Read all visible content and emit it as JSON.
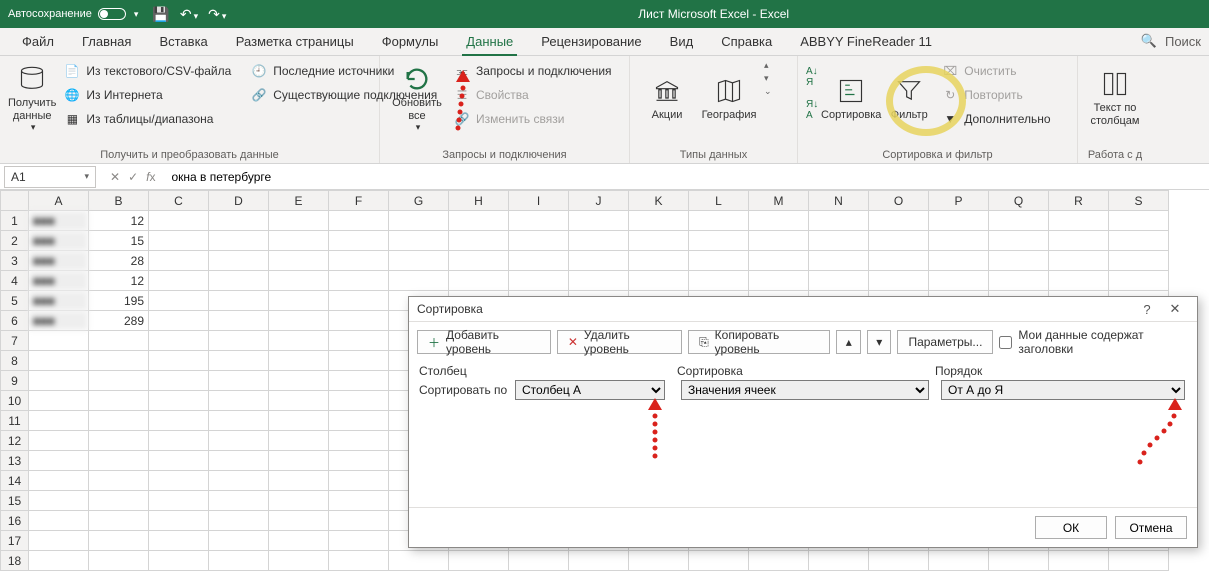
{
  "titlebar": {
    "autosave": "Автосохранение",
    "title": "Лист Microsoft Excel  -  Excel"
  },
  "tabs": {
    "file": "Файл",
    "home": "Главная",
    "insert": "Вставка",
    "layout": "Разметка страницы",
    "formulas": "Формулы",
    "data": "Данные",
    "review": "Рецензирование",
    "view": "Вид",
    "help": "Справка",
    "abbyy": "ABBYY FineReader 11",
    "search": "Поиск"
  },
  "ribbon": {
    "getdata": {
      "big": "Получить данные",
      "txtcsv": "Из текстового/CSV-файла",
      "web": "Из Интернета",
      "range": "Из таблицы/диапазона",
      "recent": "Последние источники",
      "existing": "Существующие подключения",
      "label": "Получить и преобразовать данные"
    },
    "refresh": {
      "big": "Обновить все",
      "queries": "Запросы и подключения",
      "props": "Свойства",
      "links": "Изменить связи",
      "label": "Запросы и подключения"
    },
    "dtypes": {
      "stocks": "Акции",
      "geo": "География",
      "label": "Типы данных"
    },
    "sortfilter": {
      "sort": "Сортировка",
      "filter": "Фильтр",
      "clear": "Очистить",
      "reapply": "Повторить",
      "advanced": "Дополнительно",
      "label": "Сортировка и фильтр"
    },
    "tools": {
      "ttc": "Текст по столбцам",
      "label": "Работа с д"
    }
  },
  "formulabar": {
    "name": "A1",
    "formula": "окна в петербурге"
  },
  "columns": [
    "A",
    "B",
    "C",
    "D",
    "E",
    "F",
    "G",
    "H",
    "I",
    "J",
    "K",
    "L",
    "M",
    "N",
    "O",
    "P",
    "Q",
    "R",
    "S"
  ],
  "rows": [
    {
      "n": 1,
      "a": "",
      "b": "12"
    },
    {
      "n": 2,
      "a": "",
      "b": "15"
    },
    {
      "n": 3,
      "a": "",
      "b": "28"
    },
    {
      "n": 4,
      "a": "",
      "b": "12"
    },
    {
      "n": 5,
      "a": "",
      "b": "195"
    },
    {
      "n": 6,
      "a": "",
      "b": "289"
    },
    {
      "n": 7
    },
    {
      "n": 8
    },
    {
      "n": 9
    },
    {
      "n": 10
    },
    {
      "n": 11
    },
    {
      "n": 12
    },
    {
      "n": 13
    },
    {
      "n": 14
    },
    {
      "n": 15
    },
    {
      "n": 16
    },
    {
      "n": 17
    },
    {
      "n": 18
    }
  ],
  "dialog": {
    "title": "Сортировка",
    "add": "Добавить уровень",
    "del": "Удалить уровень",
    "copy": "Копировать уровень",
    "params": "Параметры...",
    "header_chk": "Мои данные содержат заголовки",
    "col_hdr": "Столбец",
    "sort_hdr": "Сортировка",
    "order_hdr": "Порядок",
    "sortby": "Сортировать по",
    "col_val": "Столбец A",
    "sorton_val": "Значения ячеек",
    "order_val": "От А до Я",
    "ok": "ОК",
    "cancel": "Отмена"
  }
}
